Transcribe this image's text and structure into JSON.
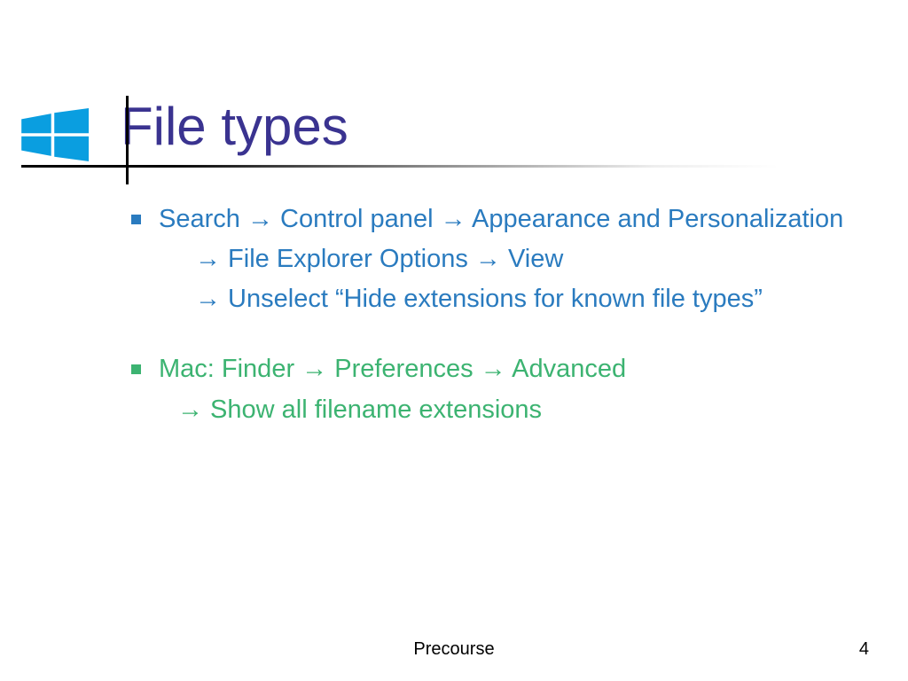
{
  "title": "File types",
  "arrow": "→",
  "windows": {
    "line1_parts": [
      "Search ",
      " Control panel ",
      " Appearance and Personalization"
    ],
    "sub1_parts": [
      " File Explorer Options ",
      " View"
    ],
    "sub2_parts": [
      " Unselect “Hide extensions for known file types”"
    ]
  },
  "mac": {
    "line1_parts": [
      "Mac: Finder ",
      " Preferences ",
      " Advanced"
    ],
    "sub1_parts": [
      " Show all filename extensions"
    ]
  },
  "footer": {
    "center": "Precourse",
    "page": "4"
  },
  "colors": {
    "title": "#3a3390",
    "blue": "#2a7bbf",
    "green": "#3cb371"
  }
}
